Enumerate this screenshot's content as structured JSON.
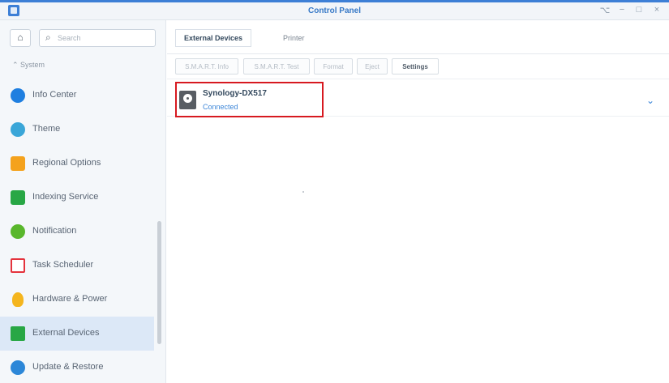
{
  "window": {
    "title": "Control Panel",
    "controls": [
      "⌥",
      "−",
      "□",
      "×"
    ]
  },
  "sidebar": {
    "home_icon": "home-icon",
    "search": {
      "placeholder": "Search"
    },
    "section": "System",
    "items": [
      {
        "label": "Info Center",
        "icon": "info-icon",
        "color": "#1f7fe0"
      },
      {
        "label": "Theme",
        "icon": "theme-icon",
        "color": "#3aa6d8"
      },
      {
        "label": "Regional Options",
        "icon": "regional-icon",
        "color": "#f4a21d"
      },
      {
        "label": "Indexing Service",
        "icon": "indexing-icon",
        "color": "#28a745"
      },
      {
        "label": "Notification",
        "icon": "notification-icon",
        "color": "#59b72c"
      },
      {
        "label": "Task Scheduler",
        "icon": "calendar-icon",
        "color": "#e4333d"
      },
      {
        "label": "Hardware & Power",
        "icon": "bulb-icon",
        "color": "#f4b51e"
      },
      {
        "label": "External Devices",
        "icon": "external-devices-icon",
        "color": "#28a745"
      },
      {
        "label": "Update & Restore",
        "icon": "update-icon",
        "color": "#2c87d8"
      }
    ],
    "active_item": "External Devices"
  },
  "main": {
    "tabs": [
      {
        "label": "External Devices"
      },
      {
        "label": "Printer"
      }
    ],
    "toolbar": {
      "smart_info": "S.M.A.R.T. Info",
      "smart_test": "S.M.A.R.T. Test",
      "format": "Format",
      "eject": "Eject",
      "settings": "Settings"
    },
    "device": {
      "name": "Synology-DX517",
      "status": "Connected"
    }
  }
}
